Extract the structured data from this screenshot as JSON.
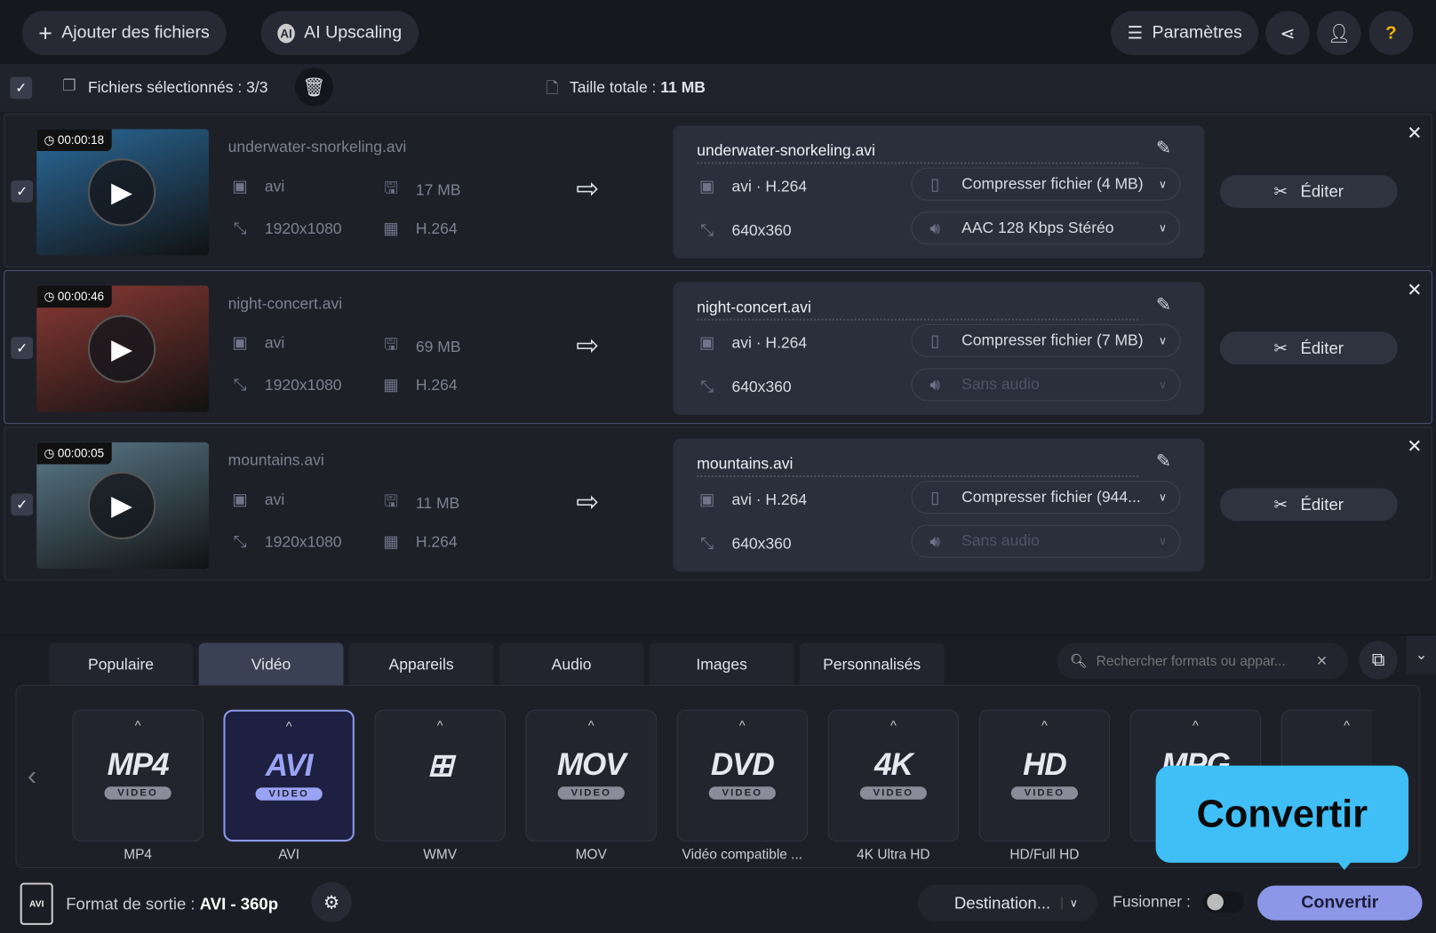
{
  "toolbar": {
    "add_files": "Ajouter des fichiers",
    "ai_upscaling": "AI Upscaling",
    "settings": "Paramètres"
  },
  "selection": {
    "label": "Fichiers sélectionnés : 3/3",
    "total_label": "Taille totale :",
    "total_value": "11 MB"
  },
  "files": [
    {
      "duration": "00:00:18",
      "name": "underwater-snorkeling.avi",
      "format": "avi",
      "size": "17 MB",
      "resolution": "1920x1080",
      "codec": "H.264",
      "out_name": "underwater-snorkeling.avi",
      "out_format": "avi · H.264",
      "out_resolution": "640x360",
      "compress": "Compresser fichier (4 MB)",
      "audio": "AAC 128 Kbps Stéréo",
      "audio_disabled": false,
      "edit": "Éditer",
      "thumb": "#2a6a9a"
    },
    {
      "duration": "00:00:46",
      "name": "night-concert.avi",
      "format": "avi",
      "size": "69 MB",
      "resolution": "1920x1080",
      "codec": "H.264",
      "out_name": "night-concert.avi",
      "out_format": "avi · H.264",
      "out_resolution": "640x360",
      "compress": "Compresser fichier (7 MB)",
      "audio": "Sans audio",
      "audio_disabled": true,
      "edit": "Éditer",
      "thumb": "#8a3a34"
    },
    {
      "duration": "00:00:05",
      "name": "mountains.avi",
      "format": "avi",
      "size": "11 MB",
      "resolution": "1920x1080",
      "codec": "H.264",
      "out_name": "mountains.avi",
      "out_format": "avi · H.264",
      "out_resolution": "640x360",
      "compress": "Compresser fichier (944...",
      "audio": "Sans audio",
      "audio_disabled": true,
      "edit": "Éditer",
      "thumb": "#5a7a8a"
    }
  ],
  "tabs": [
    "Populaire",
    "Vidéo",
    "Appareils",
    "Audio",
    "Images",
    "Personnalisés"
  ],
  "active_tab": 1,
  "search": {
    "placeholder": "Rechercher formats ou appar..."
  },
  "formats": [
    {
      "logo": "MP4",
      "sub": "VIDEO",
      "label": "MP4"
    },
    {
      "logo": "AVI",
      "sub": "VIDEO",
      "label": "AVI"
    },
    {
      "logo": "⊞",
      "sub": "",
      "label": "WMV"
    },
    {
      "logo": "MOV",
      "sub": "VIDEO",
      "label": "MOV"
    },
    {
      "logo": "DVD",
      "sub": "VIDEO",
      "label": "Vidéo compatible ..."
    },
    {
      "logo": "4K",
      "sub": "VIDEO",
      "label": "4K Ultra HD"
    },
    {
      "logo": "HD",
      "sub": "VIDEO",
      "label": "HD/Full HD"
    },
    {
      "logo": "MPG",
      "sub": "",
      "label": ""
    },
    {
      "logo": "",
      "sub": "",
      "label": ""
    }
  ],
  "footer": {
    "output_label": "Format de sortie :",
    "output_value": "AVI - 360p",
    "destination": "Destination...",
    "merge": "Fusionner :",
    "convert": "Convertir"
  },
  "tooltip": "Convertir",
  "colors": {
    "accent": "#8d97e8",
    "tooltip": "#3fbff5"
  }
}
